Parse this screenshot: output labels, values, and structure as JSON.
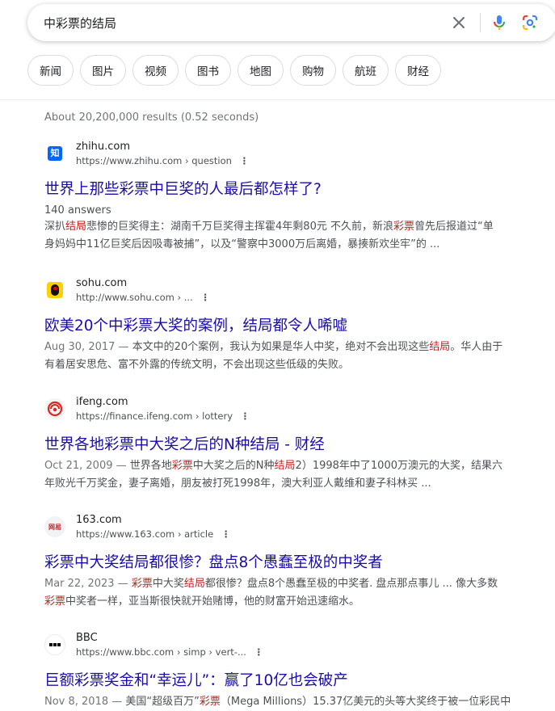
{
  "search": {
    "query": "中彩票的结局"
  },
  "chips": [
    "新闻",
    "图片",
    "视频",
    "图书",
    "地图",
    "购物",
    "航班",
    "财经"
  ],
  "stats": "About 20,200,000 results (0.52 seconds)",
  "results": [
    {
      "site": "zhihu.com",
      "url": "https://www.zhihu.com › question",
      "title": "世界上那些彩票中巨奖的人最后都怎样了?",
      "meta": "140 answers",
      "date": "",
      "snippet_lines": [
        [
          {
            "t": "深扒"
          },
          {
            "t": "结局",
            "h": true
          },
          {
            "t": "悲惨的巨奖得主：湖南千万巨奖得主挥霍4年剩80元 不久前，新浪"
          },
          {
            "t": "彩票",
            "h": true
          },
          {
            "t": "曾先后报道过“单"
          }
        ],
        [
          {
            "t": "身妈妈中11亿巨奖后因吸毒被捕”，以及“警察中3000万后离婚，暴揍新欢坐牢”的 ..."
          }
        ]
      ]
    },
    {
      "site": "sohu.com",
      "url": "http://www.sohu.com › ...",
      "title": "欧美20个中彩票大奖的案例，结局都令人唏嘘",
      "meta": "",
      "date": "Aug 30, 2017 — ",
      "snippet_lines": [
        [
          {
            "t": "本文中的20个案例，我认为如果是华人中奖，绝对不会出现这些"
          },
          {
            "t": "结局",
            "h": true
          },
          {
            "t": "。华人由于"
          }
        ],
        [
          {
            "t": "有着居安思危、富不外露的传统文明，不会出现这些低级的失败。"
          }
        ]
      ]
    },
    {
      "site": "ifeng.com",
      "url": "https://finance.ifeng.com › lottery",
      "title": "世界各地彩票中大奖之后的N种结局 - 财经",
      "meta": "",
      "date": "Oct 21, 2009 — ",
      "snippet_lines": [
        [
          {
            "t": "世界各地"
          },
          {
            "t": "彩票",
            "h": true
          },
          {
            "t": "中大奖之后的N种"
          },
          {
            "t": "结局",
            "h": true
          },
          {
            "t": "2）1998年中了1000万澳元的大奖，结果六"
          }
        ],
        [
          {
            "t": "年败光千万奖金，妻子离婚，朋友被打死1998年，澳大利亚人戴维和妻子科林买 ..."
          }
        ]
      ]
    },
    {
      "site": "163.com",
      "url": "https://www.163.com › article",
      "title": "彩票中大奖结局都很惨？盘点8个愚蠢至极的中奖者",
      "meta": "",
      "date": "Mar 22, 2023 — ",
      "snippet_lines": [
        [
          {
            "t": "彩票",
            "h": true
          },
          {
            "t": "中大奖"
          },
          {
            "t": "结局",
            "h": true
          },
          {
            "t": "都很惨？盘点8个愚蠢至极的中奖者. 盘点那点事儿 ... 像大多数"
          }
        ],
        [
          {
            "t": "彩票",
            "h": true
          },
          {
            "t": "中奖者一样，亚当斯很快就开始赌博，他的财富开始迅速缩水。"
          }
        ]
      ]
    },
    {
      "site": "BBC",
      "url": "https://www.bbc.com › simp › vert-...",
      "title": "巨额彩票奖金和“幸运儿”：赢了10亿也会破产",
      "meta": "",
      "date": "Nov 8, 2018 — ",
      "snippet_lines": [
        [
          {
            "t": "美国“超级百万”"
          },
          {
            "t": "彩票",
            "h": true
          },
          {
            "t": "（Mega Millions）15.37亿美元的头等大奖终于被一位彩民中"
          }
        ]
      ]
    }
  ],
  "favicon_icons": [
    "zhihu-icon",
    "sohu-icon",
    "ifeng-icon",
    "netease-icon",
    "bbc-icon"
  ],
  "favicon_text": {
    "zhihu": "知",
    "netease": "网易"
  },
  "colors": {
    "link": "#1a0dab",
    "highlight": "#c5221f",
    "text": "#4d5156"
  }
}
